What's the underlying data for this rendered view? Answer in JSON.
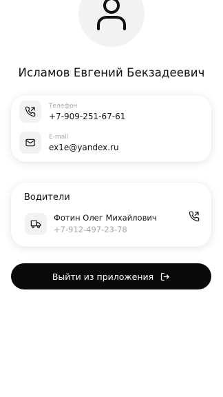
{
  "profile": {
    "name": "Исламов Евгений Бекзадеевич",
    "avatar_icon": "user-icon"
  },
  "contacts": {
    "phone": {
      "label": "Телефон",
      "value": "+7-909-251-67-61",
      "icon": "phone-call-icon"
    },
    "email": {
      "label": "E-mail",
      "value": "ex1e@yandex.ru",
      "icon": "mail-icon"
    }
  },
  "drivers": {
    "title": "Водители",
    "items": [
      {
        "name": "Фотин Олег Михайлович",
        "phone": "+7-912-497-23-78",
        "icon": "truck-icon",
        "action_icon": "phone-call-icon"
      }
    ]
  },
  "logout": {
    "label": "Выйти из приложения",
    "icon": "logout-icon"
  },
  "colors": {
    "background": "#ffffff",
    "card": "#ffffff",
    "icon_bg": "#f2f2f2",
    "text_primary": "#111111",
    "text_secondary": "#a6a6a6",
    "button_bg": "#0a0a0a",
    "button_text": "#ffffff"
  }
}
